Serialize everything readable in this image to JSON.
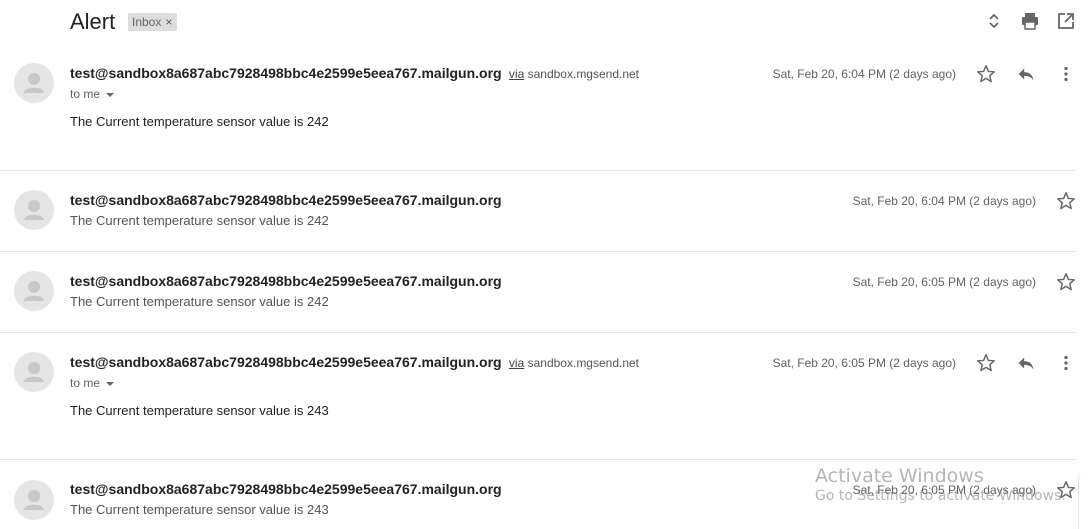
{
  "thread": {
    "subject": "Alert",
    "label": "Inbox",
    "label_remove": "×"
  },
  "header_icons": [
    "expand-collapse-icon",
    "print-icon",
    "open-new-window-icon"
  ],
  "messages": [
    {
      "sender": "test@sandbox8a687abc7928498bbc4e2599e5eea767.mailgun.org",
      "via_word": "via",
      "via_domain": "sandbox.mgsend.net",
      "recipient": "to me",
      "date": "Sat, Feb 20, 6:04 PM (2 days ago)",
      "body": "The Current temperature sensor value is 242",
      "expanded": true
    },
    {
      "sender": "test@sandbox8a687abc7928498bbc4e2599e5eea767.mailgun.org",
      "date": "Sat, Feb 20, 6:04 PM (2 days ago)",
      "snippet": "The Current temperature sensor value is 242",
      "expanded": false
    },
    {
      "sender": "test@sandbox8a687abc7928498bbc4e2599e5eea767.mailgun.org",
      "date": "Sat, Feb 20, 6:05 PM (2 days ago)",
      "snippet": "The Current temperature sensor value is 242",
      "expanded": false
    },
    {
      "sender": "test@sandbox8a687abc7928498bbc4e2599e5eea767.mailgun.org",
      "via_word": "via",
      "via_domain": "sandbox.mgsend.net",
      "recipient": "to me",
      "date": "Sat, Feb 20, 6:05 PM (2 days ago)",
      "body": "The Current temperature sensor value is 243",
      "expanded": true
    },
    {
      "sender": "test@sandbox8a687abc7928498bbc4e2599e5eea767.mailgun.org",
      "date": "Sat, Feb 20, 6:05 PM (2 days ago)",
      "snippet": "The Current temperature sensor value is 243",
      "expanded": false
    }
  ],
  "watermark": {
    "line1": "Activate Windows",
    "line2": "Go to Settings to activate Windows."
  }
}
